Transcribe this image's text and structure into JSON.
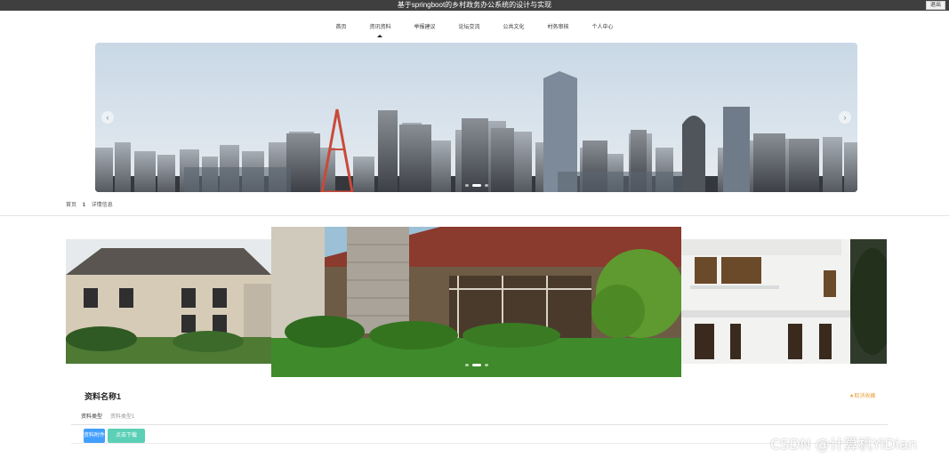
{
  "window": {
    "title": "基于springboot的乡村政务办公系统的设计与实现",
    "exit_label": "退出"
  },
  "nav": {
    "items": [
      {
        "label": "首页"
      },
      {
        "label": "资讯资料"
      },
      {
        "label": "举报建议"
      },
      {
        "label": "论坛交流"
      },
      {
        "label": "公共文化"
      },
      {
        "label": "村务审核"
      },
      {
        "label": "个人中心"
      }
    ],
    "active_index": 1
  },
  "banner": {
    "prev_icon": "chevron-left-icon",
    "next_icon": "chevron-right-icon",
    "slide_count": 3,
    "active_slide": 1
  },
  "breadcrumb": {
    "home": "首页",
    "separator": "1",
    "current": "详情信息"
  },
  "gallery": {
    "slide_count": 3,
    "active_slide": 1
  },
  "detail": {
    "title": "资料名称1",
    "favorite_label": "★取消收藏",
    "tabs": [
      {
        "label": "资料类型"
      },
      {
        "label": "资料类型1"
      }
    ],
    "buttons": {
      "primary": "资料附件",
      "secondary": "点击下载"
    }
  },
  "watermark": "CSDN @计算机YiDian",
  "colors": {
    "titlebar": "#3f3f3f",
    "accent_blue": "#409eff",
    "accent_teal": "#5bd0b6",
    "favorite": "#e8a33c"
  }
}
